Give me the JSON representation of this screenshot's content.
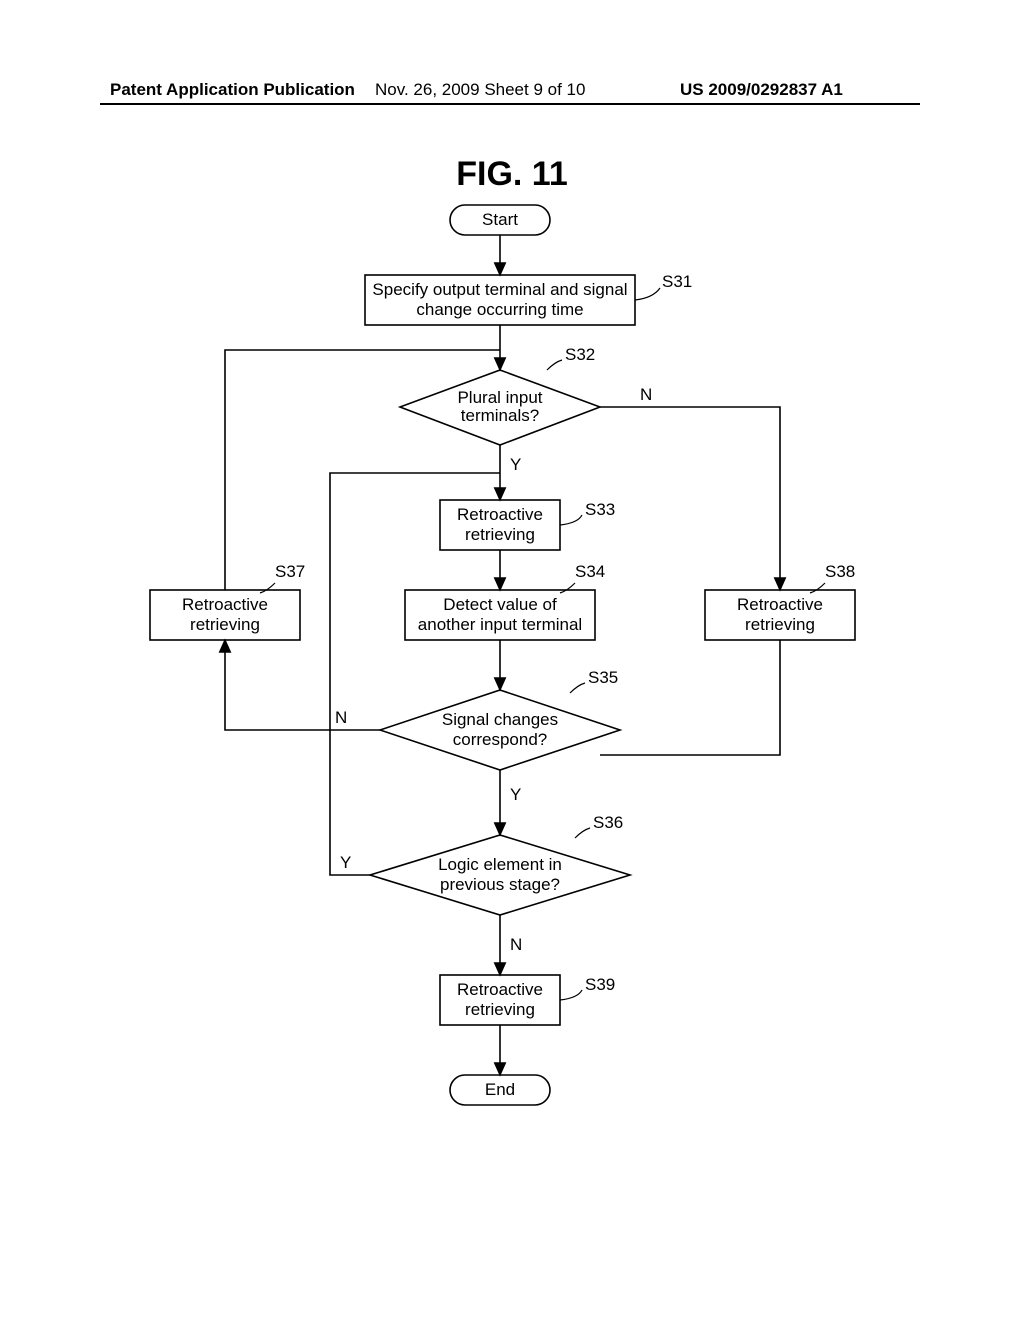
{
  "header": {
    "left": "Patent Application Publication",
    "center": "Nov. 26, 2009  Sheet 9 of 10",
    "right": "US 2009/0292837 A1"
  },
  "figure": {
    "title": "FIG.   11"
  },
  "nodes": {
    "start": "Start",
    "end": "End",
    "s31_l1": "Specify output terminal and signal",
    "s31_l2": "change occurring time",
    "s32_l1": "Plural input",
    "s32_l2": "terminals?",
    "s33_l1": "Retroactive",
    "s33_l2": "retrieving",
    "s34_l1": "Detect value of",
    "s34_l2": "another input terminal",
    "s35_l1": "Signal changes",
    "s35_l2": "correspond?",
    "s36_l1": "Logic element in",
    "s36_l2": "previous stage?",
    "s37_l1": "Retroactive",
    "s37_l2": "retrieving",
    "s38_l1": "Retroactive",
    "s38_l2": "retrieving",
    "s39_l1": "Retroactive",
    "s39_l2": "retrieving"
  },
  "labels": {
    "s31": "S31",
    "s32": "S32",
    "s33": "S33",
    "s34": "S34",
    "s35": "S35",
    "s36": "S36",
    "s37": "S37",
    "s38": "S38",
    "s39": "S39",
    "y": "Y",
    "n": "N"
  }
}
